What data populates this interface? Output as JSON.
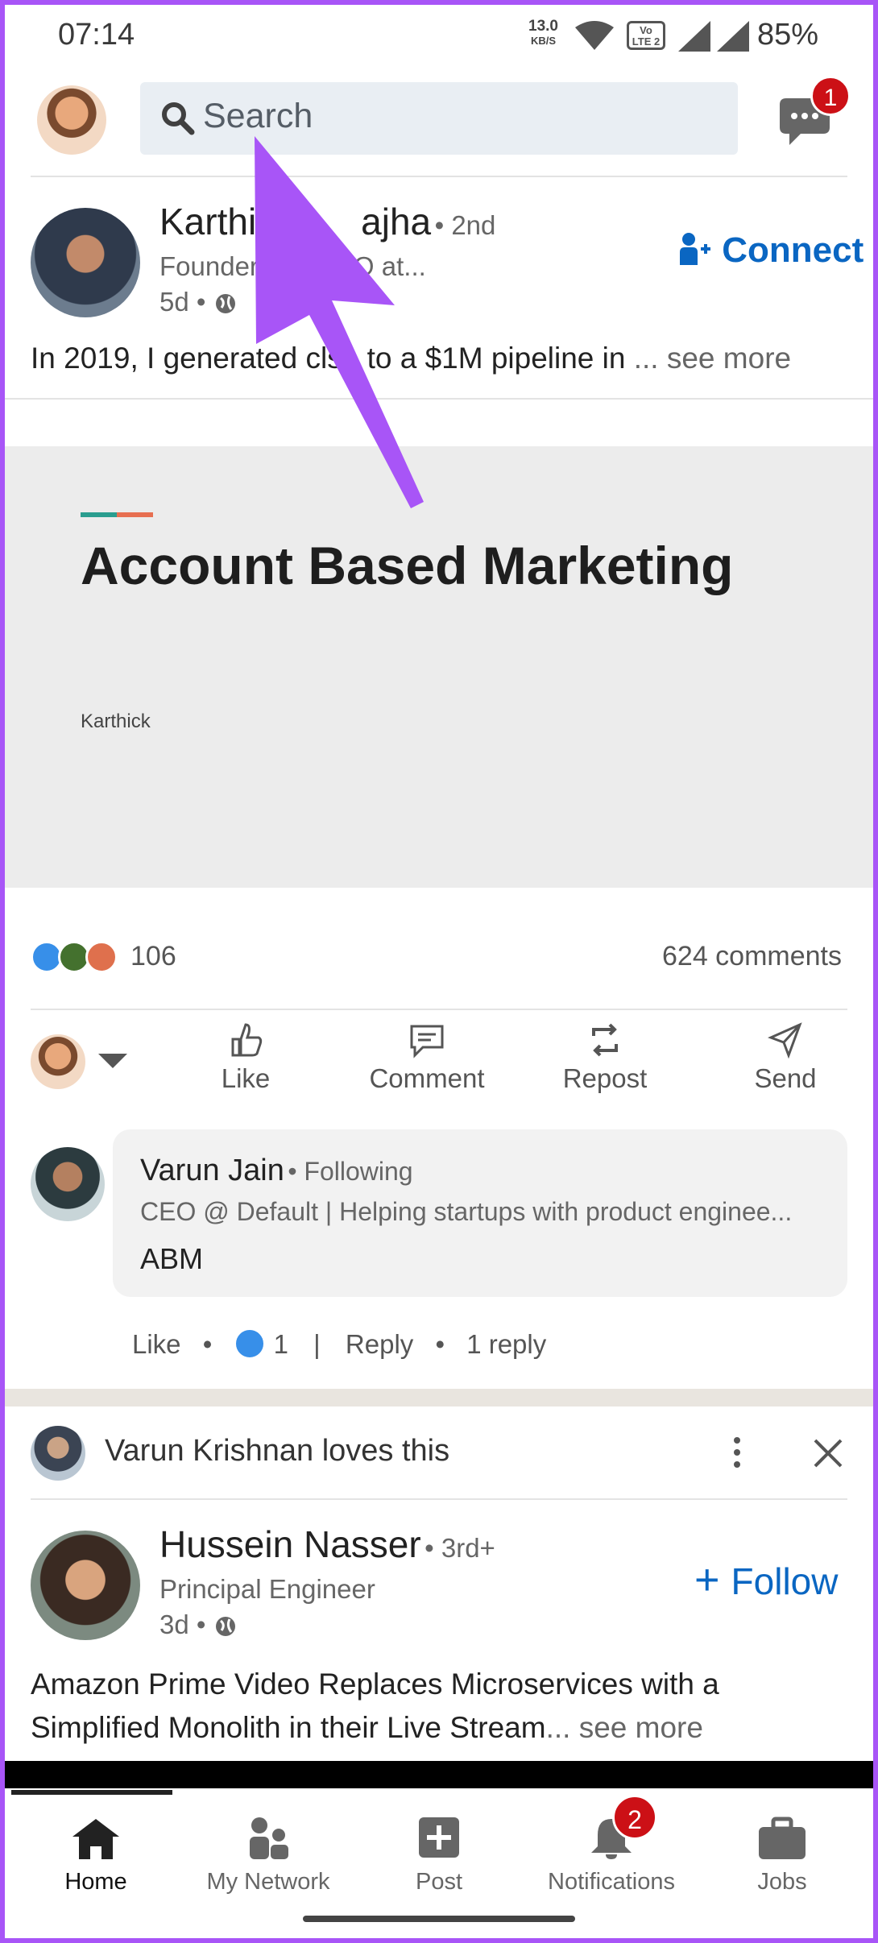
{
  "status_bar": {
    "time": "07:14",
    "net_speed": "13.0",
    "net_unit": "KB/S",
    "volte": "Vo LTE 2",
    "battery": "85%"
  },
  "header": {
    "search_placeholder": "Search",
    "messages_badge": "1"
  },
  "post1": {
    "author": "Karthi",
    "author_tail": "ajha",
    "degree": "• 2nd",
    "headline": "Founder",
    "headline_tail": "EO at...",
    "age": "5d •",
    "connect_label": "Connect",
    "text_a": "In 2019, I generated cl",
    "text_b": "se to a $1M pipeline in ",
    "text_ellipsis": "...",
    "see_more": "see more",
    "document": {
      "title": "Account Based Marketing",
      "author": "Karthick"
    },
    "reactions_count": "106",
    "comments_count": "624 comments",
    "actions": [
      "Like",
      "Comment",
      "Repost",
      "Send"
    ]
  },
  "comment": {
    "name": "Varun Jain",
    "relation": "• Following",
    "headline": "CEO @ Default | Helping startups with product enginee...",
    "body": "ABM",
    "like_label": "Like",
    "like_count": "1",
    "reply_label": "Reply",
    "replies": "1 reply"
  },
  "post2": {
    "social_name": "Varun Krishnan",
    "social_action": "loves this",
    "author": "Hussein Nasser",
    "degree": "• 3rd+",
    "headline": "Principal Engineer",
    "age": "3d •",
    "follow_label": "Follow",
    "text_line1": "Amazon Prime Video Replaces Microservices with a",
    "text_line2": "Simplified Monolith in their Live Stream",
    "text_ellipsis": "...",
    "see_more": "see more"
  },
  "bottom_nav": {
    "items": [
      {
        "label": "Home"
      },
      {
        "label": "My Network"
      },
      {
        "label": "Post"
      },
      {
        "label": "Notifications",
        "badge": "2"
      },
      {
        "label": "Jobs"
      }
    ]
  },
  "colors": {
    "accent": "#0a66c2",
    "annotation_arrow": "#a855f7",
    "badge": "#cc1016"
  }
}
